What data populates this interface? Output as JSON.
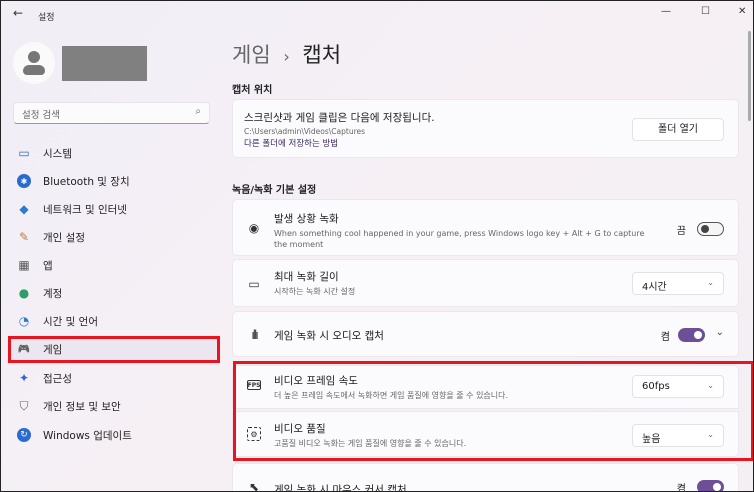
{
  "window": {
    "title": "설정",
    "back": "←",
    "minimize": "—",
    "maximize": "☐",
    "close": "✕"
  },
  "user": {
    "avatar": "user-avatar"
  },
  "search": {
    "placeholder": "설정 검색"
  },
  "sidebar": {
    "items": [
      {
        "label": "시스템",
        "icon": "▭"
      },
      {
        "label": "Bluetooth 및 장치",
        "icon": "✱"
      },
      {
        "label": "네트워크 및 인터넷",
        "icon": "◆"
      },
      {
        "label": "개인 설정",
        "icon": "✎"
      },
      {
        "label": "앱",
        "icon": "▦"
      },
      {
        "label": "계정",
        "icon": "●"
      },
      {
        "label": "시간 및 언어",
        "icon": "◔"
      },
      {
        "label": "게임",
        "icon": "🎮"
      },
      {
        "label": "접근성",
        "icon": "✦"
      },
      {
        "label": "개인 정보 및 보안",
        "icon": "⛉"
      },
      {
        "label": "Windows 업데이트",
        "icon": "↻"
      }
    ]
  },
  "breadcrumb": {
    "parent": "게임",
    "sep": "›",
    "current": "캡처"
  },
  "capture_location": {
    "header": "캡처 위치",
    "title": "스크린샷과 게임 클립은 다음에 저장됩니다.",
    "path": "C:\\Users\\admin\\Videos\\Captures",
    "link": "다른 폴더에 저장하는 방법",
    "button": "폴더 열기"
  },
  "recording": {
    "header": "녹음/녹화 기본 설정",
    "background": {
      "title": "발생 상황 녹화",
      "sub": "When something cool happened in your game, press Windows logo key + Alt + G to capture the moment",
      "state": "끔"
    },
    "max_length": {
      "title": "최대 녹화 길이",
      "sub": "시작하는 녹화 시간 설정",
      "value": "4시간"
    },
    "audio": {
      "title": "게임 녹화 시 오디오 캡처",
      "state": "켬"
    },
    "fps": {
      "title": "비디오 프레임 속도",
      "sub": "더 높은 프레임 속도에서 녹화하면 게임 품질에 영향을 줄 수 있습니다.",
      "value": "60fps",
      "icon": "FPS"
    },
    "quality": {
      "title": "비디오 품질",
      "sub": "고품질 비디오 녹화는 게임 품질에 영향을 줄 수 있습니다.",
      "value": "높음"
    },
    "cursor": {
      "title": "게임 녹화 시 마우스 커서 캡처",
      "state": "켬"
    }
  }
}
